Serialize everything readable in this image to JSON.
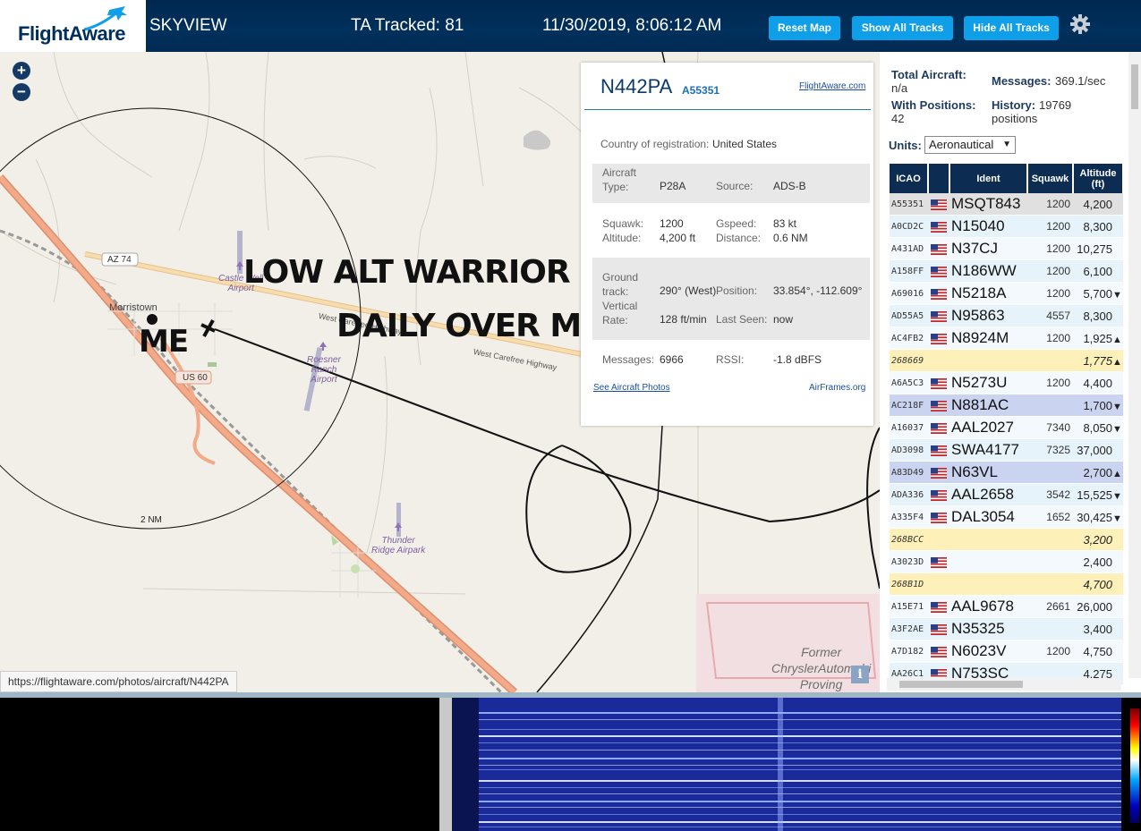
{
  "header": {
    "logo": "FlightAware",
    "app_name": "SKYVIEW",
    "tracked_label": "TA Tracked: 81",
    "datetime": "11/30/2019, 8:06:12 AM",
    "buttons": {
      "reset": "Reset Map",
      "show_all": "Show All Tracks",
      "hide_all": "Hide All Tracks"
    }
  },
  "map": {
    "labels": {
      "town": "Morristown",
      "road_az74": "AZ 74",
      "road_us60": "US 60",
      "highway": "West Carefree Highway",
      "range": "2 NM"
    },
    "airports": {
      "castle_well": [
        "Castle Well",
        "Airport"
      ],
      "roesner": [
        "Roesner",
        "Ranch",
        "Airport"
      ],
      "thunder": [
        "Thunder",
        "Ridge Airpark"
      ],
      "chrysler": [
        "Former",
        "ChryslerAutomobi",
        "Proving"
      ]
    },
    "overlay": {
      "line1": "LOW ALT WARRIOR",
      "line2": "DAILY OVER Me",
      "me": "ME"
    },
    "status_url": "https://flightaware.com/photos/aircraft/N442PA",
    "info_button": "i"
  },
  "popup": {
    "callsign": "N442PA",
    "hex": "A55351",
    "flightaware_link": "FlightAware.com",
    "country_label": "Country of registration:",
    "country": "United States",
    "aircraft_type_label": [
      "Aircraft",
      "Type:"
    ],
    "aircraft_type": "P28A",
    "source_label": "Source:",
    "source": "ADS-B",
    "squawk_label": "Squawk:",
    "squawk": "1200",
    "gspeed_label": "Gspeed:",
    "gspeed": "83 kt",
    "altitude_label": "Altitude:",
    "altitude": "4,200 ft",
    "distance_label": "Distance:",
    "distance": "0.6 NM",
    "ground_track_label": [
      "Ground",
      "track:"
    ],
    "ground_track": "290° (West)",
    "position_label": "Position:",
    "position": "33.854°, -112.609°",
    "vrate_label": [
      "Vertical",
      "Rate:"
    ],
    "vrate": "128 ft/min",
    "last_seen_label": "Last Seen:",
    "last_seen": "now",
    "messages_label": "Messages:",
    "messages": "6966",
    "rssi_label": "RSSI:",
    "rssi": "-1.8 dBFS",
    "photos_link": "See Aircraft Photos",
    "airframes_link": "AirFrames.org"
  },
  "sidebar": {
    "total_aircraft_label": "Total Aircraft:",
    "total_aircraft": "n/a",
    "messages_label": "Messages:",
    "messages": "369.1/sec",
    "with_positions_label": "With Positions:",
    "with_positions": "42",
    "history_label": "History:",
    "history": "19769",
    "history_unit": "positions",
    "units_label": "Units:",
    "units_value": "Aeronautical",
    "table_headers": {
      "icao": "ICAO",
      "ident": "Ident",
      "squawk": "Squawk",
      "altitude": [
        "Altitude",
        "(ft)"
      ]
    },
    "rows": [
      {
        "icao": "A55351",
        "flag": true,
        "ident": "MSQT843",
        "squawk": "1200",
        "alt": "4,200",
        "trend": "",
        "style": "sel"
      },
      {
        "icao": "A0CD2C",
        "flag": true,
        "ident": "N15040",
        "squawk": "1200",
        "alt": "8,300",
        "trend": "",
        "style": "a"
      },
      {
        "icao": "A431AD",
        "flag": true,
        "ident": "N37CJ",
        "squawk": "1200",
        "alt": "10,275",
        "trend": "",
        "style": "b"
      },
      {
        "icao": "A158FF",
        "flag": true,
        "ident": "N186WW",
        "squawk": "1200",
        "alt": "6,100",
        "trend": "",
        "style": "a"
      },
      {
        "icao": "A69016",
        "flag": true,
        "ident": "N5218A",
        "squawk": "1200",
        "alt": "5,700",
        "trend": "▼",
        "style": "b"
      },
      {
        "icao": "AD55A5",
        "flag": true,
        "ident": "N95863",
        "squawk": "4557",
        "alt": "8,300",
        "trend": "",
        "style": "a"
      },
      {
        "icao": "AC4FB2",
        "flag": true,
        "ident": "N8924M",
        "squawk": "1200",
        "alt": "1,925",
        "trend": "▲",
        "style": "b"
      },
      {
        "icao": "268669",
        "flag": false,
        "ident": "",
        "squawk": "",
        "alt": "1,775",
        "trend": "▲",
        "style": "yel"
      },
      {
        "icao": "A6A5C3",
        "flag": true,
        "ident": "N5273U",
        "squawk": "1200",
        "alt": "4,400",
        "trend": "",
        "style": "b"
      },
      {
        "icao": "AC218F",
        "flag": true,
        "ident": "N881AC",
        "squawk": "",
        "alt": "1,700",
        "trend": "▼",
        "style": "hi"
      },
      {
        "icao": "A16037",
        "flag": true,
        "ident": "AAL2027",
        "squawk": "7340",
        "alt": "8,050",
        "trend": "▼",
        "style": "b"
      },
      {
        "icao": "AD3098",
        "flag": true,
        "ident": "SWA4177",
        "squawk": "7325",
        "alt": "37,000",
        "trend": "",
        "style": "a"
      },
      {
        "icao": "A83D49",
        "flag": true,
        "ident": "N63VL",
        "squawk": "",
        "alt": "2,700",
        "trend": "▲",
        "style": "hi"
      },
      {
        "icao": "ADA336",
        "flag": true,
        "ident": "AAL2658",
        "squawk": "3542",
        "alt": "15,525",
        "trend": "▼",
        "style": "a"
      },
      {
        "icao": "A335F4",
        "flag": true,
        "ident": "DAL3054",
        "squawk": "1652",
        "alt": "30,425",
        "trend": "▼",
        "style": "b"
      },
      {
        "icao": "268BCC",
        "flag": false,
        "ident": "",
        "squawk": "",
        "alt": "3,200",
        "trend": "",
        "style": "yel"
      },
      {
        "icao": "A3023D",
        "flag": true,
        "ident": "",
        "squawk": "",
        "alt": "2,400",
        "trend": "",
        "style": "b"
      },
      {
        "icao": "268B1D",
        "flag": false,
        "ident": "",
        "squawk": "",
        "alt": "4,700",
        "trend": "",
        "style": "yel"
      },
      {
        "icao": "A15E71",
        "flag": true,
        "ident": "AAL9678",
        "squawk": "2661",
        "alt": "26,000",
        "trend": "",
        "style": "b"
      },
      {
        "icao": "A3F2AE",
        "flag": true,
        "ident": "N35325",
        "squawk": "",
        "alt": "3,400",
        "trend": "",
        "style": "a"
      },
      {
        "icao": "A7D182",
        "flag": true,
        "ident": "N6023V",
        "squawk": "1200",
        "alt": "4,750",
        "trend": "",
        "style": "b"
      },
      {
        "icao": "AA26C1",
        "flag": true,
        "ident": "N753SC",
        "squawk": "",
        "alt": "4,275",
        "trend": "",
        "style": "a"
      }
    ]
  },
  "colors": {
    "header_bg": "#002f5d",
    "button_blue": "#0f9ee8",
    "table_header": "#0d2c52",
    "row_selected": "#e0e0e0",
    "row_highlight": "#cad3ef",
    "row_unknown": "#fdf0b8",
    "road_orange": "#f0a07a"
  }
}
